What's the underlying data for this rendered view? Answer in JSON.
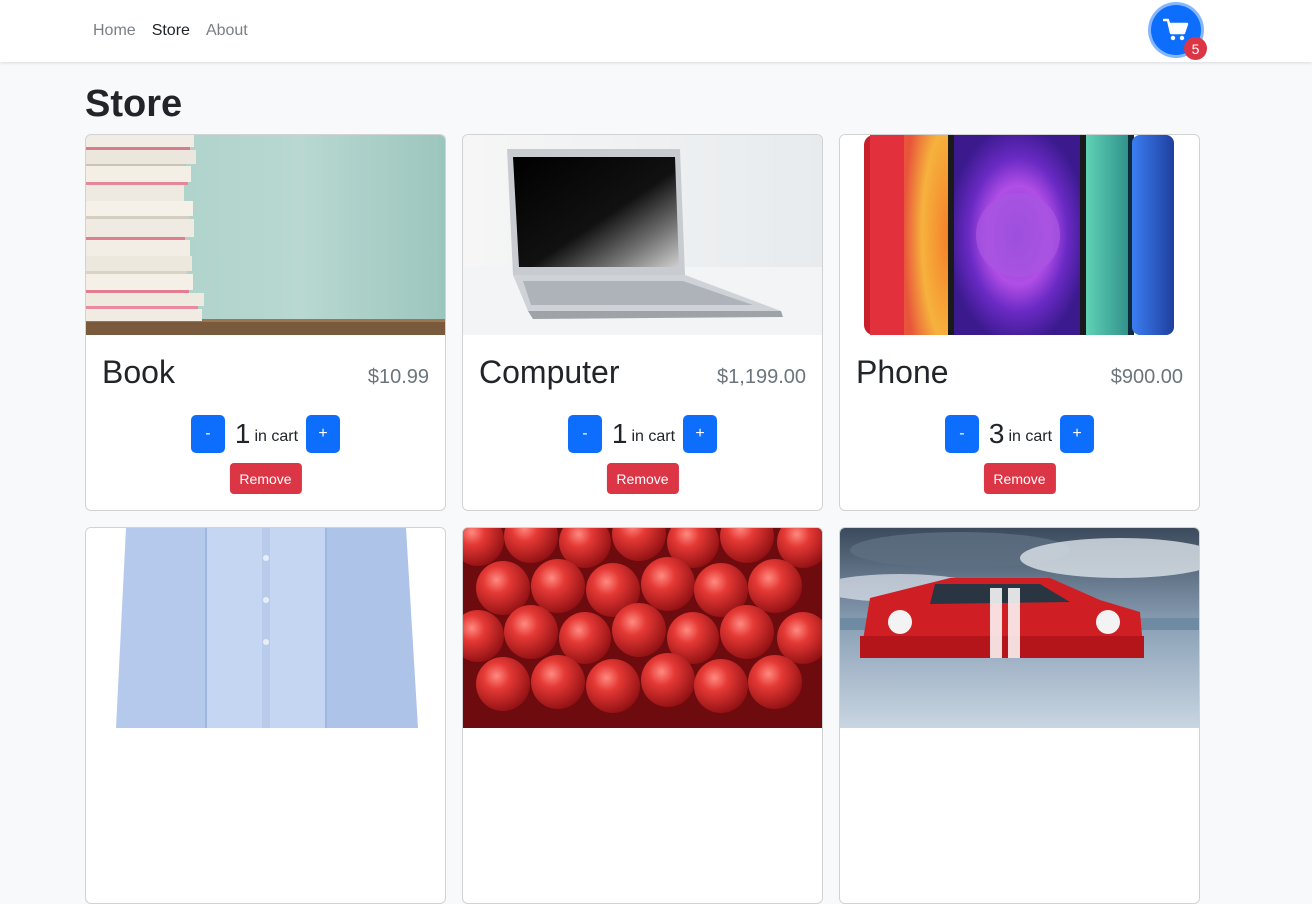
{
  "nav": {
    "links": [
      {
        "label": "Home"
      },
      {
        "label": "Store"
      },
      {
        "label": "About"
      }
    ],
    "cart": {
      "icon": "shopping-cart-icon",
      "count": "5"
    }
  },
  "page": {
    "title": "Store"
  },
  "products": [
    {
      "name": "Book",
      "price": "$10.99",
      "quantity": "1",
      "in_cart_label": "in cart",
      "decrement_label": "-",
      "increment_label": "+",
      "remove_label": "Remove"
    },
    {
      "name": "Computer",
      "price": "$1,199.00",
      "quantity": "1",
      "in_cart_label": "in cart",
      "decrement_label": "-",
      "increment_label": "+",
      "remove_label": "Remove"
    },
    {
      "name": "Phone",
      "price": "$900.00",
      "quantity": "3",
      "in_cart_label": "in cart",
      "decrement_label": "-",
      "increment_label": "+",
      "remove_label": "Remove"
    },
    {
      "name": "",
      "price": ""
    },
    {
      "name": "",
      "price": ""
    },
    {
      "name": "",
      "price": ""
    }
  ],
  "colors": {
    "primary": "#0d6efd",
    "danger": "#dc3545",
    "price_text": "#6c757d",
    "page_background": "#f8f9fa"
  }
}
